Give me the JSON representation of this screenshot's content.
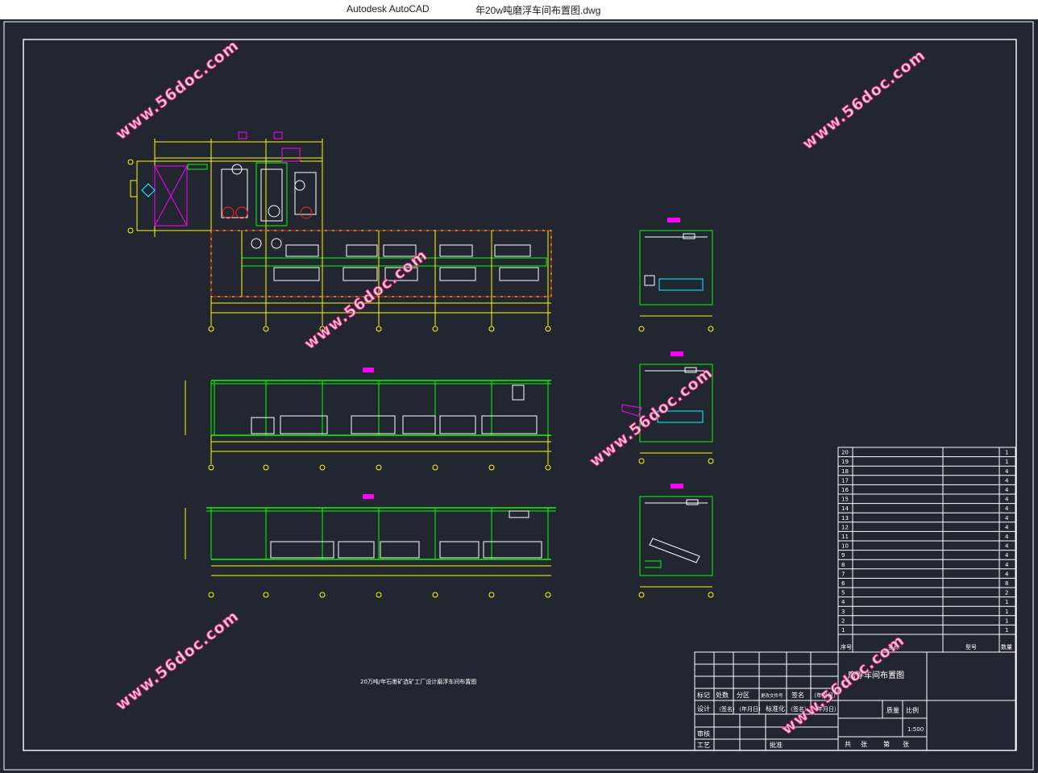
{
  "window": {
    "app_name": "Autodesk AutoCAD",
    "document_name": "年20w吨磨浮车间布置图.dwg"
  },
  "drawing": {
    "main_title": "20万吨/年石墨矿选矿工厂设计磨浮车间布置图",
    "watermarks": [
      "www.56doc.com",
      "www.56doc.com",
      "www.56doc.com",
      "www.56doc.com",
      "www.56doc.com",
      "www.56doc.com",
      "www.56doc.com"
    ],
    "colors": {
      "background": "#222631",
      "frame": "#ffffff",
      "walls": "#ffff00",
      "equipment": "#ffffff",
      "red": "#ff2020",
      "green": "#00ff00",
      "cyan": "#00ffff",
      "magenta": "#ff00ff",
      "watermark_stroke": "#ff1e82"
    }
  },
  "title_block": {
    "title": "磨浮车间布置图",
    "label_marker": "标记",
    "label_count": "处数",
    "label_zone": "分区",
    "label_change_doc": "更改文件号",
    "label_signature": "签名",
    "label_date": "（年月日）",
    "label_design": "设计",
    "label_signature2": "（签名）",
    "label_date2": "（年月日）",
    "label_standard": "标准化",
    "label_signature3": "（签名）",
    "label_date3": "（年月日）",
    "label_review": "审核",
    "label_process": "工艺",
    "label_approve": "批准",
    "label_weight": "质量",
    "label_scale": "比例",
    "scale_value": "1:500",
    "label_total": "共",
    "label_sheets": "张",
    "label_page": "第",
    "label_sheet": "张"
  },
  "parts_list": {
    "footer": {
      "seq": "序号",
      "name": "名称",
      "model": "型号",
      "qty": "数量"
    },
    "rows": [
      {
        "no": "20",
        "name": "",
        "model": "",
        "qty": "1"
      },
      {
        "no": "19",
        "name": "",
        "model": "",
        "qty": "1"
      },
      {
        "no": "18",
        "name": "",
        "model": "",
        "qty": "4"
      },
      {
        "no": "17",
        "name": "",
        "model": "",
        "qty": "4"
      },
      {
        "no": "16",
        "name": "",
        "model": "",
        "qty": "4"
      },
      {
        "no": "15",
        "name": "",
        "model": "",
        "qty": "4"
      },
      {
        "no": "14",
        "name": "",
        "model": "",
        "qty": "4"
      },
      {
        "no": "13",
        "name": "",
        "model": "",
        "qty": "4"
      },
      {
        "no": "12",
        "name": "",
        "model": "",
        "qty": "4"
      },
      {
        "no": "11",
        "name": "",
        "model": "",
        "qty": "4"
      },
      {
        "no": "10",
        "name": "",
        "model": "",
        "qty": "4"
      },
      {
        "no": "9",
        "name": "",
        "model": "",
        "qty": "4"
      },
      {
        "no": "8",
        "name": "",
        "model": "",
        "qty": "4"
      },
      {
        "no": "7",
        "name": "",
        "model": "",
        "qty": "4"
      },
      {
        "no": "6",
        "name": "",
        "model": "",
        "qty": "8"
      },
      {
        "no": "5",
        "name": "",
        "model": "",
        "qty": "2"
      },
      {
        "no": "4",
        "name": "",
        "model": "",
        "qty": "1"
      },
      {
        "no": "3",
        "name": "",
        "model": "",
        "qty": "1"
      },
      {
        "no": "2",
        "name": "",
        "model": "",
        "qty": "1"
      },
      {
        "no": "1",
        "name": "",
        "model": "",
        "qty": "1"
      }
    ]
  }
}
